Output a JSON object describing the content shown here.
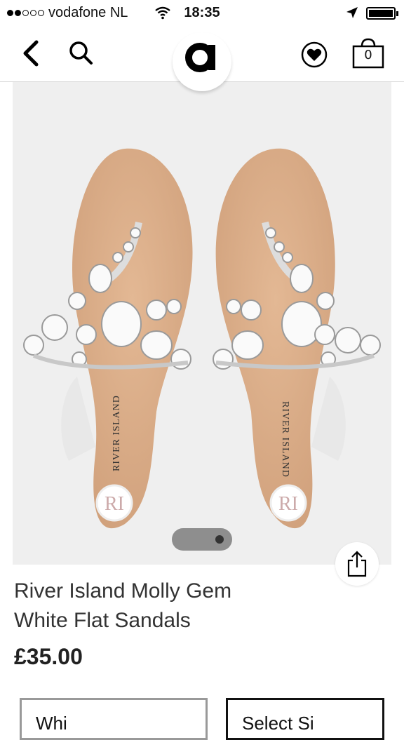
{
  "status_bar": {
    "carrier": "vodafone NL",
    "time": "18:35"
  },
  "nav": {
    "bag_count": "0"
  },
  "product": {
    "brand_print": "RIVER ISLAND",
    "title_line1": "River Island Molly Gem",
    "title_line2": "White Flat Sandals",
    "price": "£35.00",
    "colour_select": "Whi",
    "size_select": "Select Si"
  },
  "colors": {
    "sole": "#d9a983",
    "background": "#efefef",
    "pager": "#8e8e8e"
  }
}
